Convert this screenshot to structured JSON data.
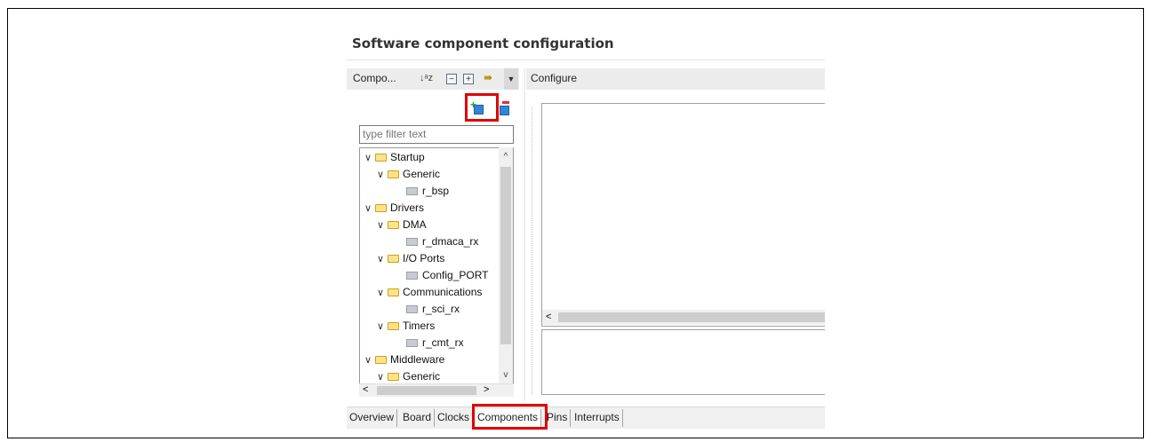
{
  "page": {
    "title": "Software component configuration"
  },
  "left_panel": {
    "header_label": "Compo...",
    "toolbar_icons": [
      "sort-alpha-icon",
      "collapse-all-icon",
      "expand-all-icon",
      "link-icon",
      "view-menu-icon"
    ],
    "toolbar_text": {
      "sort": "↓ᵃz",
      "collapse": "−",
      "expand": "+",
      "link": "⇛",
      "menu": "▼"
    },
    "filter_placeholder": "type filter text",
    "tree": [
      {
        "label": "Startup",
        "type": "folder",
        "level": 0
      },
      {
        "label": "Generic",
        "type": "folder",
        "level": 1
      },
      {
        "label": "r_bsp",
        "type": "component",
        "level": 2
      },
      {
        "label": "Drivers",
        "type": "folder",
        "level": 0
      },
      {
        "label": "DMA",
        "type": "folder",
        "level": 1
      },
      {
        "label": "r_dmaca_rx",
        "type": "component",
        "level": 2
      },
      {
        "label": "I/O Ports",
        "type": "folder",
        "level": 1
      },
      {
        "label": "Config_PORT",
        "type": "component",
        "level": 2
      },
      {
        "label": "Communications",
        "type": "folder",
        "level": 1
      },
      {
        "label": "r_sci_rx",
        "type": "component",
        "level": 2
      },
      {
        "label": "Timers",
        "type": "folder",
        "level": 1
      },
      {
        "label": "r_cmt_rx",
        "type": "component",
        "level": 2
      },
      {
        "label": "Middleware",
        "type": "folder",
        "level": 0
      },
      {
        "label": "Generic",
        "type": "folder",
        "level": 1
      }
    ],
    "scroll_glyphs": {
      "up": "^",
      "down": "v",
      "left": "<",
      "right": ">"
    }
  },
  "right_panel": {
    "header_label": "Configure",
    "scroll_left": "<"
  },
  "tabs": [
    {
      "label": "Overview"
    },
    {
      "label": "Board"
    },
    {
      "label": "Clocks"
    },
    {
      "label": "Components",
      "active": true
    },
    {
      "label": "Pins"
    },
    {
      "label": "Interrupts"
    }
  ],
  "colors": {
    "highlight": "#e00000",
    "header_bg": "#ececec",
    "tab_bar": "#f0f0f0"
  }
}
